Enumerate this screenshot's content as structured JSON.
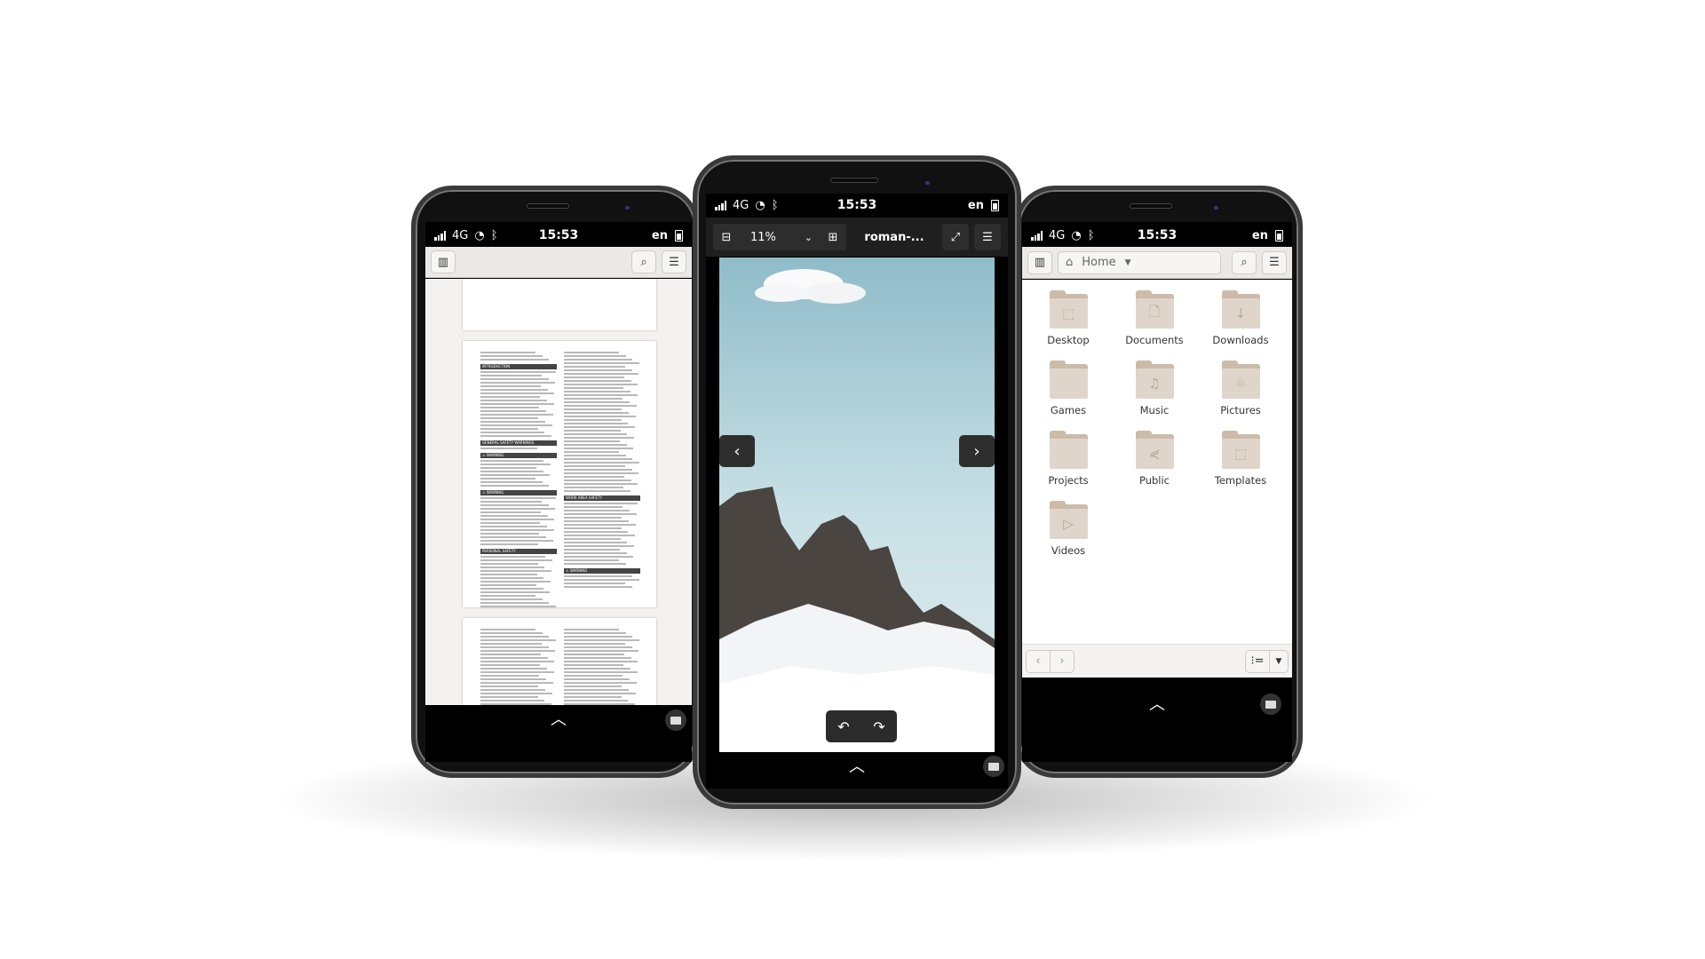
{
  "status": {
    "network": "4G",
    "time": "15:53",
    "lang": "en"
  },
  "doc_viewer": {
    "headings": [
      "INTRODUCTION",
      "GENERAL SAFETY WARNINGS",
      "⚠ WARNING",
      "⚠ WARNING",
      "PERSONAL SAFETY",
      "WORK AREA SAFETY",
      "⚠ WARNING"
    ]
  },
  "image_viewer": {
    "zoom": "11%",
    "filename": "roman-..."
  },
  "files": {
    "location": "Home",
    "folders": [
      {
        "name": "Desktop",
        "icon": "desktop-icon",
        "glyph": "⬚"
      },
      {
        "name": "Documents",
        "icon": "document-icon",
        "glyph": "🗋"
      },
      {
        "name": "Downloads",
        "icon": "download-icon",
        "glyph": "↓"
      },
      {
        "name": "Games",
        "icon": "",
        "glyph": ""
      },
      {
        "name": "Music",
        "icon": "music-icon",
        "glyph": "♫"
      },
      {
        "name": "Pictures",
        "icon": "camera-icon",
        "glyph": "⌾"
      },
      {
        "name": "Projects",
        "icon": "",
        "glyph": ""
      },
      {
        "name": "Public",
        "icon": "share-icon",
        "glyph": "⋞"
      },
      {
        "name": "Templates",
        "icon": "template-icon",
        "glyph": "⬚"
      },
      {
        "name": "Videos",
        "icon": "video-icon",
        "glyph": "▷"
      }
    ]
  }
}
